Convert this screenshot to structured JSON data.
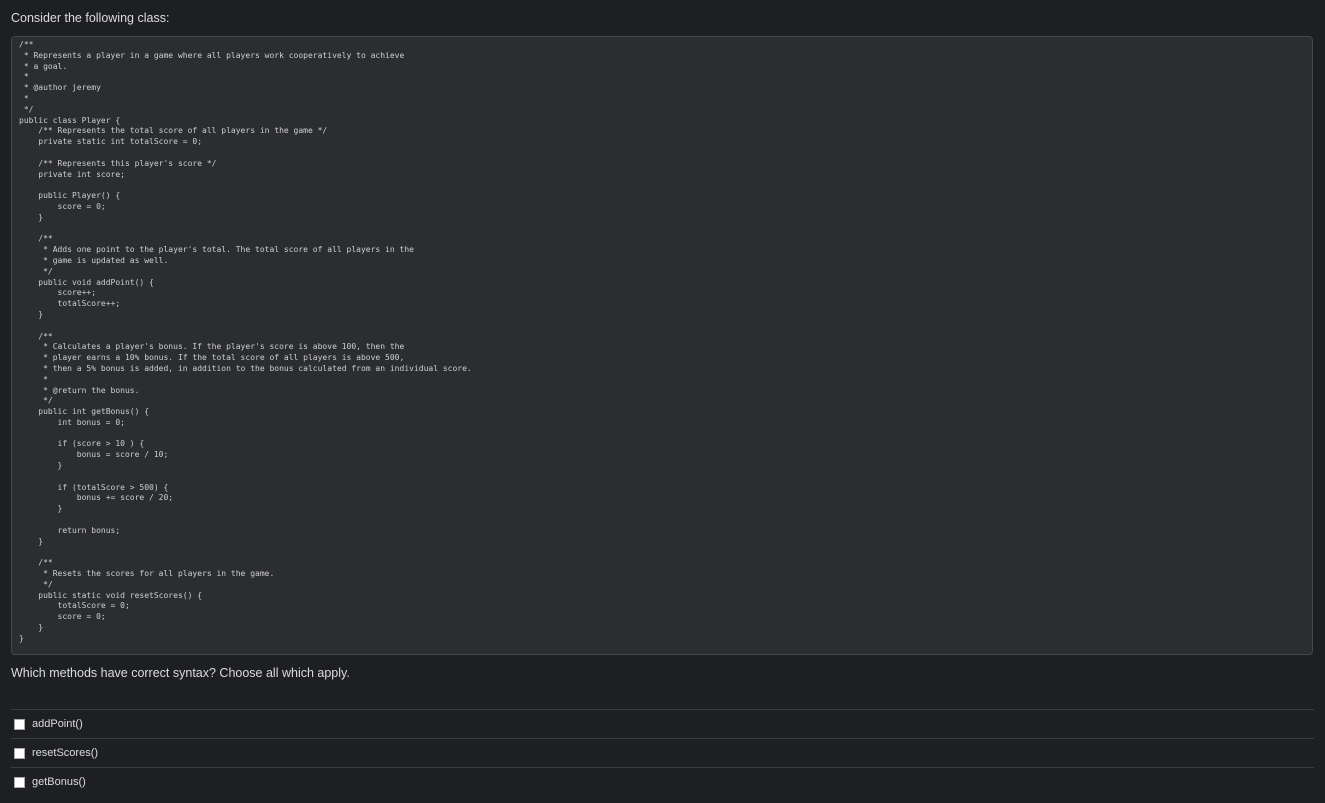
{
  "question": {
    "intro": "Consider the following class:",
    "prompt": "Which methods have correct syntax? Choose all which apply."
  },
  "code": "/**\n * Represents a player in a game where all players work cooperatively to achieve\n * a goal.\n *\n * @author jeremy\n *\n */\npublic class Player {\n    /** Represents the total score of all players in the game */\n    private static int totalScore = 0;\n\n    /** Represents this player's score */\n    private int score;\n\n    public Player() {\n        score = 0;\n    }\n\n    /**\n     * Adds one point to the player's total. The total score of all players in the\n     * game is updated as well.\n     */\n    public void addPoint() {\n        score++;\n        totalScore++;\n    }\n\n    /**\n     * Calculates a player's bonus. If the player's score is above 100, then the\n     * player earns a 10% bonus. If the total score of all players is above 500,\n     * then a 5% bonus is added, in addition to the bonus calculated from an individual score.\n     *\n     * @return the bonus.\n     */\n    public int getBonus() {\n        int bonus = 0;\n\n        if (score > 10 ) {\n            bonus = score / 10;\n        }\n\n        if (totalScore > 500) {\n            bonus += score / 20;\n        }\n\n        return bonus;\n    }\n\n    /**\n     * Resets the scores for all players in the game.\n     */\n    public static void resetScores() {\n        totalScore = 0;\n        score = 0;\n    }\n}",
  "options": [
    {
      "label": "addPoint()",
      "checked": false
    },
    {
      "label": "resetScores()",
      "checked": false
    },
    {
      "label": "getBonus()",
      "checked": false
    }
  ]
}
